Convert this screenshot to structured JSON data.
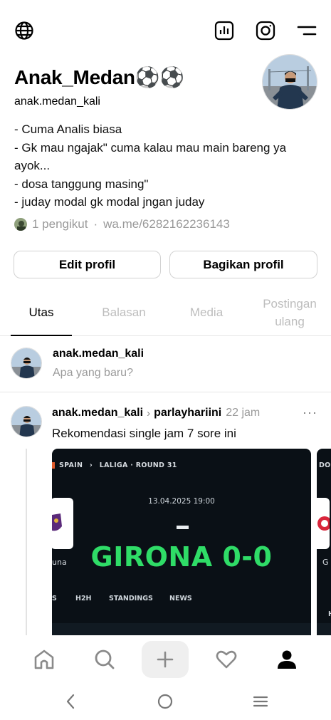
{
  "profile": {
    "display_name": "Anak_Medan⚽⚽",
    "handle": "anak.medan_kali",
    "bio_lines": [
      "- Cuma Analis biasa",
      "- Gk mau ngajak\" cuma kalau mau main bareng ya ayok...",
      "- dosa tanggung masing\"",
      "- juday modal gk modal jngan juday"
    ],
    "followers_text": "1 pengikut",
    "separator": "·",
    "link_text": "wa.me/6282162236143"
  },
  "buttons": {
    "edit_profile": "Edit profil",
    "share_profile": "Bagikan profil"
  },
  "tabs": [
    {
      "label": "Utas",
      "active": true
    },
    {
      "label": "Balasan",
      "active": false
    },
    {
      "label": "Media",
      "active": false
    },
    {
      "label": "Postingan ulang",
      "active": false
    }
  ],
  "composer": {
    "username": "anak.medan_kali",
    "placeholder": "Apa yang baru?"
  },
  "post": {
    "author": "anak.medan_kali",
    "arrow": "›",
    "community": "parlayhariini",
    "time": "22 jam",
    "more": "···",
    "text": "Rekomendasi single jam 7 sore ini",
    "card": {
      "breadcrumb_country": "SPAIN",
      "breadcrumb_sep": "›",
      "breadcrumb_league": "LALIGA · ROUND 31",
      "date": "13.04.2025 19:00",
      "score": "GIRONA 0-0",
      "left_team_partial": "una",
      "right_team_partial": "G",
      "tabs": [
        "S",
        "H2H",
        "STANDINGS",
        "NEWS"
      ]
    },
    "card2": {
      "breadcrumb_partial": "DO",
      "tab_partial": "H"
    }
  },
  "icons": {
    "top_left": "globe-icon",
    "top_right": [
      "insights-icon",
      "instagram-icon",
      "menu-icon"
    ],
    "bottom_nav": [
      "home-icon",
      "search-icon",
      "plus-icon",
      "heart-icon",
      "profile-icon"
    ],
    "system_nav": [
      "back-icon",
      "home-circle-icon",
      "recents-icon"
    ]
  },
  "colors": {
    "score_green": "#2fdc67",
    "card_bg": "#0a1016",
    "muted_text": "#999999"
  }
}
